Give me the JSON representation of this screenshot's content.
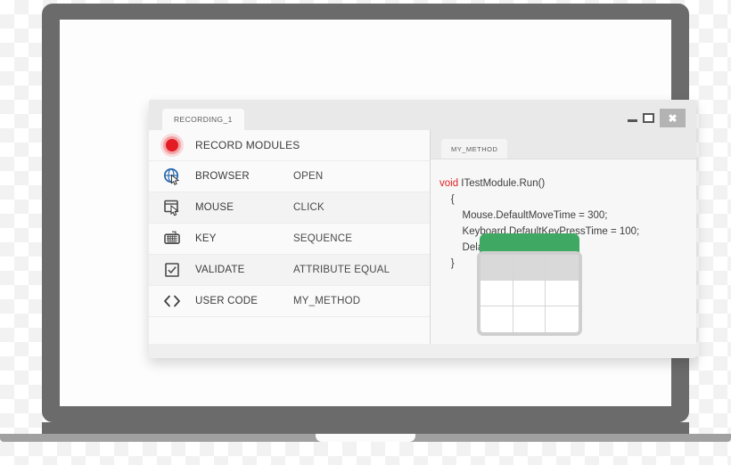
{
  "window": {
    "tab_label": "RECORDING_1",
    "controls": {
      "minimize": "minimize-icon",
      "maximize": "maximize-icon",
      "close": "✖"
    }
  },
  "modules": {
    "header": {
      "icon": "record-icon",
      "label": "RECORD MODULES",
      "value": ""
    },
    "rows": [
      {
        "icon": "browser-globe-cursor-icon",
        "label": "BROWSER",
        "value": "OPEN"
      },
      {
        "icon": "mouse-window-cursor-icon",
        "label": "MOUSE",
        "value": "CLICK"
      },
      {
        "icon": "keyboard-icon",
        "label": "KEY",
        "value": "SEQUENCE"
      },
      {
        "icon": "checkbox-check-icon",
        "label": "VALIDATE",
        "value": "ATTRIBUTE EQUAL"
      },
      {
        "icon": "angle-brackets-icon",
        "label": "USER CODE",
        "value": "MY_METHOD"
      }
    ]
  },
  "editor": {
    "tab_label": "MY_METHOD",
    "keyword": "void",
    "signature": " ITestModule.Run()",
    "lines": [
      "    {",
      "        Mouse.DefaultMoveTime = 300;",
      "        Keyboard.DefaultKeyPressTime = 100;",
      "        Delay.SpeedFactor = 1.0;",
      "    }"
    ]
  },
  "badge": {
    "name": "calendar-grid-badge",
    "header_color": "#3fa863"
  },
  "colors": {
    "record_red": "#e31b23",
    "keyword_red": "#e02020",
    "bezel": "#6b6b6b",
    "green": "#3fa863"
  }
}
